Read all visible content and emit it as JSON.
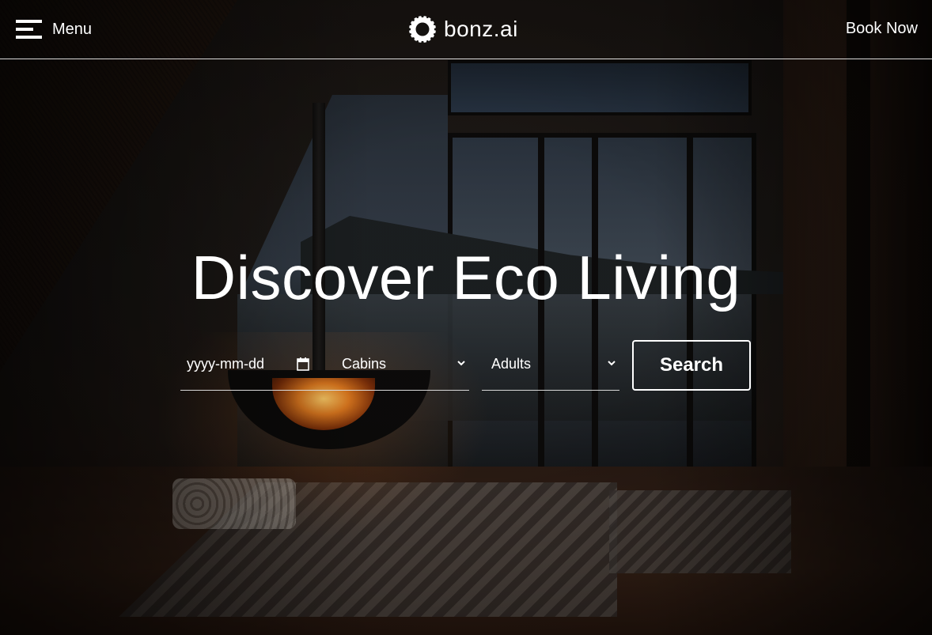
{
  "header": {
    "menu_label": "Menu",
    "brand_name": "bonz.ai",
    "book_now_label": "Book Now"
  },
  "hero": {
    "title": "Discover Eco Living"
  },
  "search_form": {
    "date_placeholder": "yyyy-mm-dd",
    "accommodation_selected": "Cabins",
    "guests_selected": "Adults",
    "search_label": "Search"
  },
  "icons": {
    "menu": "hamburger-icon",
    "brand": "bonzai-logo-icon",
    "date": "calendar-icon",
    "dropdown": "chevron-down-icon"
  },
  "colors": {
    "text": "#ffffff",
    "divider": "#ffffff"
  }
}
